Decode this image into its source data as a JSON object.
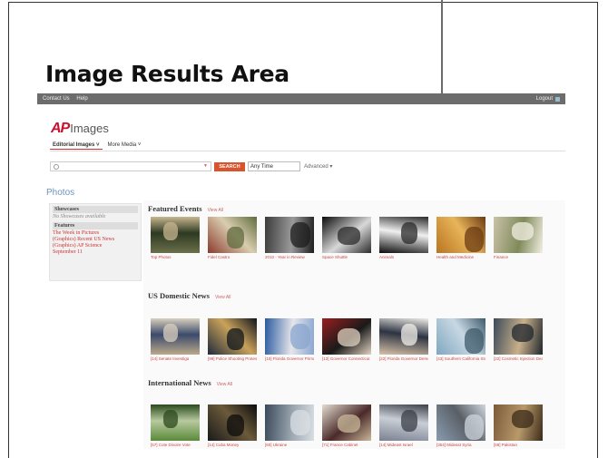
{
  "slide": {
    "title": "Image Results Area"
  },
  "app": {
    "topbar": {
      "links": [
        "Contact Us",
        "Help"
      ],
      "logout": "Logout"
    },
    "logo": {
      "brand": "AP",
      "product": "Images"
    },
    "tabs": [
      {
        "label": "Editorial Images",
        "suffix": "˅",
        "active": true
      },
      {
        "label": "More Media",
        "suffix": "˅",
        "active": false
      }
    ],
    "search": {
      "placeholder": "",
      "button": "SEARCH",
      "time": "Any Time",
      "advanced": "Advanced ▾"
    },
    "section_title": "Photos",
    "sidebar": {
      "showcases_header": "Showcases",
      "showcases_note": "No Showcases available",
      "features_header": "Features",
      "features": [
        "The Week in Pictures",
        "(Graphics) Recent US News",
        "(Graphics) AP Science",
        "September 11"
      ]
    },
    "categories": [
      {
        "title": "Featured Events",
        "view_all": "View All",
        "items": [
          {
            "caption": "Top Photos",
            "colors": [
              "#6b6f4a",
              "#2d3a22",
              "#c8b690"
            ]
          },
          {
            "caption": "Fidel Castro",
            "colors": [
              "#8a3b2d",
              "#d9cdb0",
              "#5f6b3c"
            ]
          },
          {
            "caption": "2010 - Year in Review",
            "colors": [
              "#3b3b3b",
              "#9a9a9a",
              "#1c1c1c"
            ]
          },
          {
            "caption": "Space Shuttle",
            "colors": [
              "#0a0a0a",
              "#d8d8d8",
              "#2b2b2b"
            ]
          },
          {
            "caption": "Animals",
            "colors": [
              "#0c0c0c",
              "#f0f0f0",
              "#2a2a2a"
            ]
          },
          {
            "caption": "Health and Medicine",
            "colors": [
              "#b8741f",
              "#e8b45a",
              "#6b3b12"
            ]
          },
          {
            "caption": "Finance",
            "colors": [
              "#c9c2a8",
              "#7f8a5a",
              "#f2efe3"
            ]
          }
        ]
      },
      {
        "title": "US Domestic News",
        "view_all": "View All",
        "items": [
          {
            "caption": "[14] Senate Investiga",
            "colors": [
              "#bba98a",
              "#3b4a6b",
              "#d9d0bf"
            ]
          },
          {
            "caption": "[99] Police Shooting Protest",
            "colors": [
              "#1f2a3a",
              "#c9a25a",
              "#0f141c"
            ]
          },
          {
            "caption": "[10] Florida Governor Primary",
            "colors": [
              "#2a5aa0",
              "#e5e5ea",
              "#8aa6cf"
            ]
          },
          {
            "caption": "[13] Governor Connecticut Debate",
            "colors": [
              "#9a1f1f",
              "#1a1a1a",
              "#e0d2c0"
            ]
          },
          {
            "caption": "[22] Florida Governor Democrats",
            "colors": [
              "#d7c2a8",
              "#2c3342",
              "#f2efe9"
            ]
          },
          {
            "caption": "[43] Southern California Storm Surf",
            "colors": [
              "#7fa7c0",
              "#c8d8e3",
              "#3e5a6b"
            ]
          },
          {
            "caption": "[22] Cosmetic Injection Death",
            "colors": [
              "#3b4a5a",
              "#c9b08a",
              "#1f262e"
            ]
          }
        ]
      },
      {
        "title": "International News",
        "view_all": "View All",
        "items": [
          {
            "caption": "[57] Cote Divoire Vote",
            "colors": [
              "#5a8a3a",
              "#b8c9a0",
              "#2b4a1c"
            ]
          },
          {
            "caption": "[14] Cuba Money",
            "colors": [
              "#1a1a1a",
              "#6b5a3b",
              "#0c0c0c"
            ]
          },
          {
            "caption": "[60] Ukraine",
            "colors": [
              "#3b4a5a",
              "#9aa6b0",
              "#d9dfe3"
            ]
          },
          {
            "caption": "[71] France Cabinet",
            "colors": [
              "#e5ddd0",
              "#4a2a2a",
              "#c9b89a"
            ]
          },
          {
            "caption": "[14] Mideast Israel",
            "colors": [
              "#7a8090",
              "#c9ced6",
              "#3a3f48"
            ]
          },
          {
            "caption": "[354] Mideast Syria",
            "colors": [
              "#8a9cb0",
              "#5a5f66",
              "#cfd6dd"
            ]
          },
          {
            "caption": "[59] Pakistan",
            "colors": [
              "#7a5a3a",
              "#b89a6a",
              "#3b2a1a"
            ]
          }
        ]
      }
    ]
  }
}
